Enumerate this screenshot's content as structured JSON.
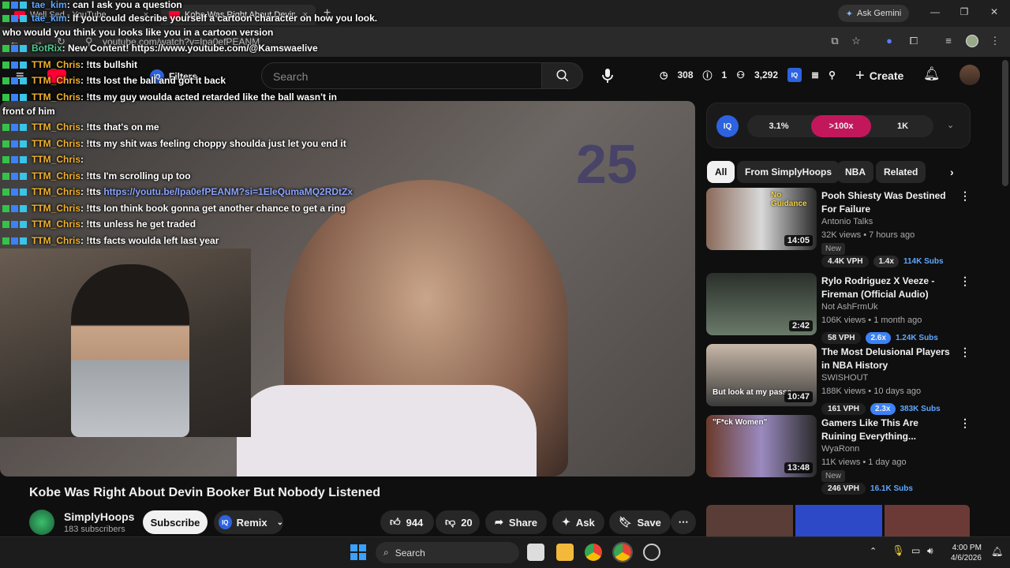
{
  "browser": {
    "tabs": [
      {
        "title": "Well Sed - YouTube",
        "close": "×"
      },
      {
        "title": "Kobe Was Right About Devin B",
        "close": "×"
      }
    ],
    "new_tab": "+",
    "gemini": "Ask Gemini",
    "url": "youtube.com/watch?v=Ipa0efPEANM",
    "window_min": "—",
    "window_max": "❐",
    "window_close": "✕"
  },
  "youtube": {
    "filters_label": "Filters",
    "search_placeholder": "Search",
    "header_stats": {
      "views": "308",
      "count": "1",
      "subs": "3,292"
    },
    "create_label": "Create"
  },
  "chat": [
    {
      "user": "tae_kim",
      "text": ": can I ask you a question",
      "color": "blue"
    },
    {
      "user": "tae_kim",
      "text": ": If you could describe yourself a cartoon character on how you look.",
      "color": "blue"
    },
    {
      "user": "",
      "text": "who would you think you looks like you in a cartoon version",
      "color": ""
    },
    {
      "user": "BotRix",
      "text": ": New Content! https://www.youtube.com/@Kamswaelive",
      "color": "teal"
    },
    {
      "user": "TTM_Chris",
      "text": ": !tts bullshit",
      "color": ""
    },
    {
      "user": "TTM_Chris",
      "text": ": !tts lost the ball and got it back",
      "color": ""
    },
    {
      "user": "TTM_Chris",
      "text": ": !tts my guy woulda acted retarded like the ball wasn't in",
      "color": ""
    },
    {
      "user": "",
      "text": "front of him",
      "color": ""
    },
    {
      "user": "TTM_Chris",
      "text": ": !tts that's on me",
      "color": ""
    },
    {
      "user": "TTM_Chris",
      "text": ": !tts my shit was feeling choppy shoulda just let you end it",
      "color": ""
    },
    {
      "user": "TTM_Chris",
      "text": ":",
      "color": ""
    },
    {
      "user": "TTM_Chris",
      "text": ": !tts I'm scrolling up too",
      "color": ""
    },
    {
      "user": "TTM_Chris",
      "text": ": !tts ",
      "color": "",
      "link": "https://youtu.be/Ipa0efPEANM?si=1EleQumaMQ2RDtZx"
    },
    {
      "user": "TTM_Chris",
      "text": ": !tts Ion think book gonna get another chance to get a ring",
      "color": ""
    },
    {
      "user": "TTM_Chris",
      "text": ": !tts unless he get traded",
      "color": ""
    },
    {
      "user": "TTM_Chris",
      "text": ": !tts facts woulda left last year",
      "color": ""
    }
  ],
  "video": {
    "jersey_number": "25",
    "title": "Kobe Was Right About Devin Booker But Nobody Listened",
    "channel": "SimplyHoops",
    "subscribers": "183 subscribers",
    "subscribe_label": "Subscribe",
    "remix_label": "Remix",
    "likes": "944",
    "dislikes": "20",
    "share_label": "Share",
    "ask_label": "Ask",
    "save_label": "Save"
  },
  "iq_bar": {
    "logo": "IQ",
    "segments": [
      "3.1%",
      ">100x",
      "1K"
    ]
  },
  "chips": [
    "All",
    "From SimplyHoops",
    "NBA",
    "Related"
  ],
  "related": [
    {
      "title": "Pooh Shiesty Was Destined For Failure",
      "channel": "Antonio Talks",
      "meta": "32K views • 7 hours ago",
      "badge": "New",
      "duration": "14:05",
      "thumb_text": "No Guidance",
      "vph": "4.4K VPH",
      "mult": "1.4x",
      "subs": "114K Subs"
    },
    {
      "title": "Rylo Rodriguez X Veeze - Fireman (Official Audio)",
      "channel": "Not AshFrmUk",
      "meta": "106K views • 1 month ago",
      "badge": "",
      "duration": "2:42",
      "thumb_text": "",
      "vph": "58 VPH",
      "mult": "2.6x",
      "subs": "1.24K Subs"
    },
    {
      "title": "The Most Delusional Players in NBA History",
      "channel": "SWISHOUT",
      "meta": "188K views • 10 days ago",
      "badge": "",
      "duration": "10:47",
      "thumb_text": "But look at my passe",
      "vph": "161 VPH",
      "mult": "2.3x",
      "subs": "383K Subs"
    },
    {
      "title": "Gamers Like This Are Ruining Everything...",
      "channel": "WyaRonn",
      "meta": "11K views • 1 day ago",
      "badge": "New",
      "duration": "13:48",
      "thumb_text": "\"F*ck Women\"",
      "vph": "246 VPH",
      "mult": "",
      "subs": "16.1K Subs"
    }
  ],
  "taskbar": {
    "search_label": "Search",
    "time": "4:00 PM",
    "date": "4/6/2026"
  },
  "colors": {
    "accent_iq": "#2d63e0",
    "hot_segment": "#c2185b",
    "subscribe_bg": "#f1f1f1"
  }
}
